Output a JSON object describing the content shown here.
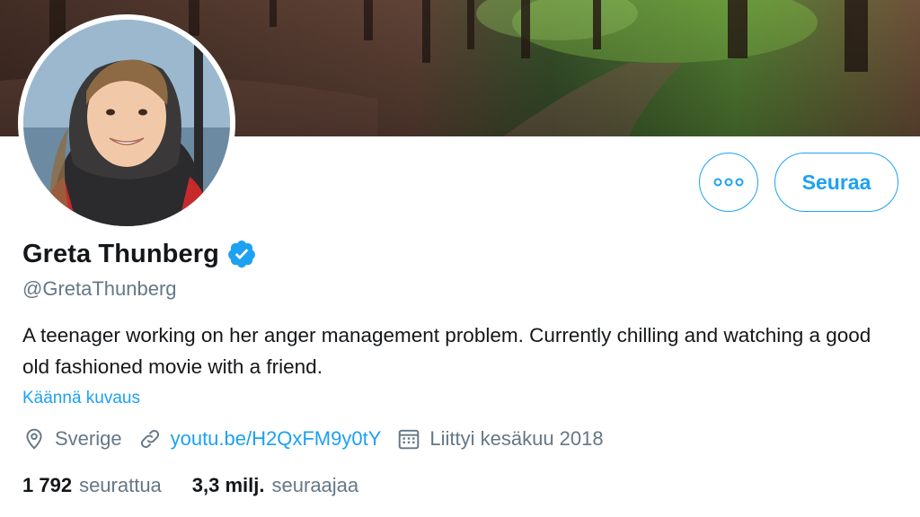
{
  "profile": {
    "name": "Greta Thunberg",
    "handle": "@GretaThunberg",
    "bio": "A teenager working on her anger management problem. Currently chilling and watching a good old fashioned movie with a friend.",
    "translate_label": "Käännä kuvaus",
    "location": "Sverige",
    "url": "youtu.be/H2QxFM9y0tY",
    "joined": "Liittyi kesäkuu 2018",
    "following_count": "1 792",
    "following_label": "seurattua",
    "followers_count": "3,3 milj.",
    "followers_label": "seuraajaa"
  },
  "actions": {
    "follow_label": "Seuraa"
  },
  "icons": {
    "more": "more-icon",
    "verified": "verified-badge-icon",
    "location": "location-pin-icon",
    "link": "link-icon",
    "calendar": "calendar-icon"
  },
  "colors": {
    "accent": "#1da1f2",
    "text_primary": "#14171a",
    "text_secondary": "#657786"
  }
}
